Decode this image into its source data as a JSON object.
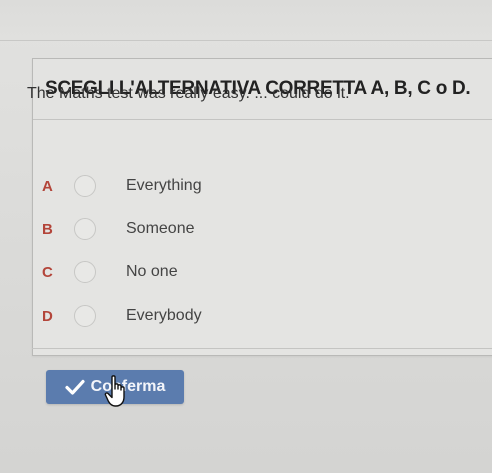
{
  "card": {
    "title": "SCEGLI L'ALTERNATIVA CORRETTA A, B, C o D."
  },
  "question": {
    "text": "The Maths test was really easy. ... could do it."
  },
  "options": [
    {
      "letter": "A",
      "label": "Everything"
    },
    {
      "letter": "B",
      "label": "Someone"
    },
    {
      "letter": "C",
      "label": "No one"
    },
    {
      "letter": "D",
      "label": "Everybody"
    }
  ],
  "confirm": {
    "label": "Conferma",
    "icon": "check-icon"
  },
  "cursor": {
    "icon": "hand-pointer-icon"
  },
  "colors": {
    "letter": "#b3453a",
    "button": "#5b7cae"
  }
}
